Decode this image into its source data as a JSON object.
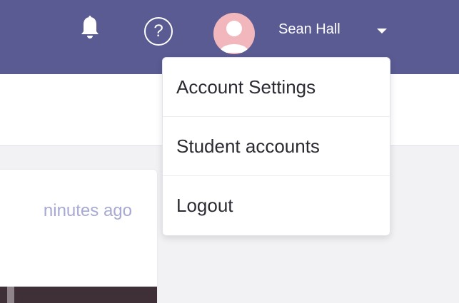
{
  "header": {
    "icons": {
      "notifications": "bell-icon",
      "help": "question-circle-icon",
      "account_menu": "chevron-down-icon"
    },
    "help_glyph": "?",
    "user": {
      "name": "Sean Hall",
      "avatar": "avatar-icon"
    }
  },
  "user_menu": {
    "items": [
      {
        "label": "Account Settings"
      },
      {
        "label": "Student accounts"
      },
      {
        "label": "Logout"
      }
    ]
  },
  "activity_card": {
    "timestamp": "ninutes ago"
  },
  "colors": {
    "header_bg": "#5a5b93",
    "page_bg": "#f2f2f4",
    "timestamp_text": "#a7a9d3",
    "menu_text": "#2b2b33",
    "avatar_bg": "#f2b7bd"
  }
}
